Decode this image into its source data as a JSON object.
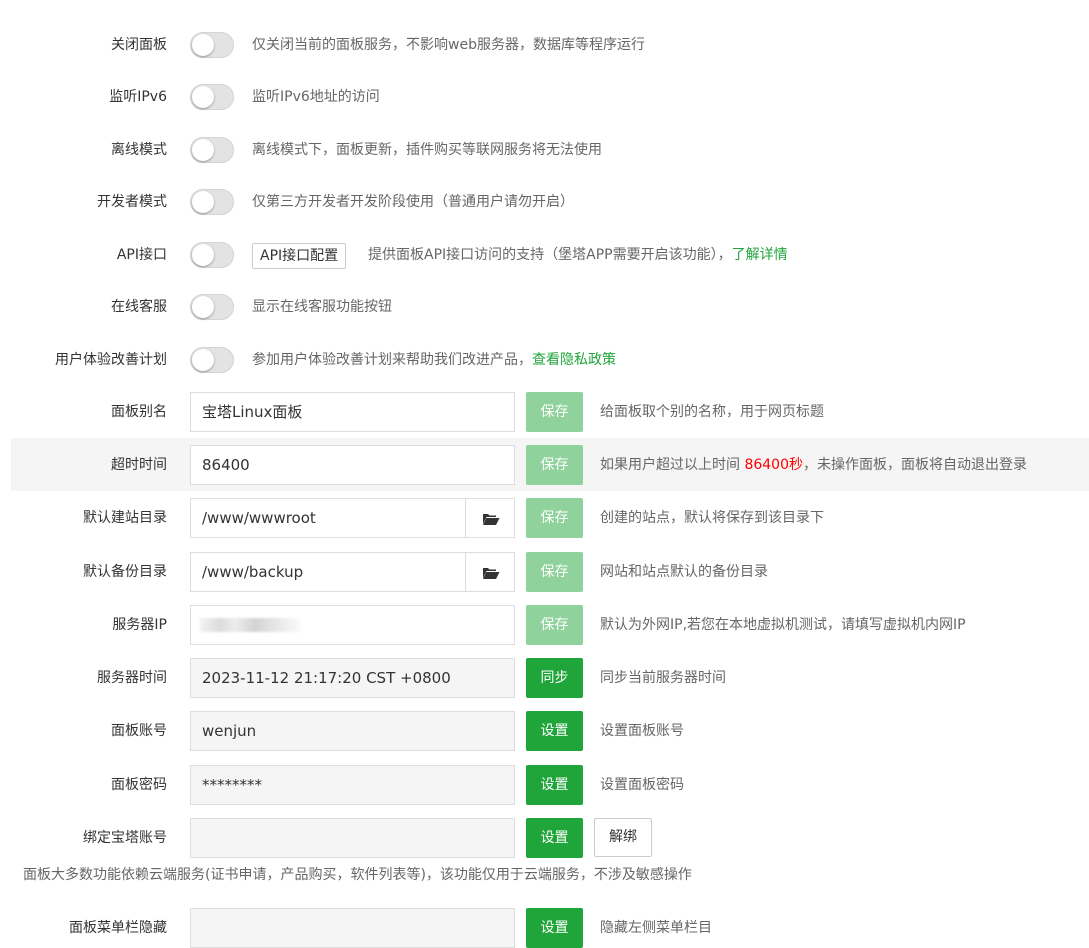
{
  "toggles": [
    {
      "label": "关闭面板",
      "enabled": false,
      "description": "仅关闭当前的面板服务，不影响web服务器，数据库等程序运行"
    },
    {
      "label": "监听IPv6",
      "enabled": false,
      "description": "监听IPv6地址的访问"
    },
    {
      "label": "离线模式",
      "enabled": false,
      "description": "离线模式下，面板更新，插件购买等联网服务将无法使用"
    },
    {
      "label": "开发者模式",
      "enabled": false,
      "description": "仅第三方开发者开发阶段使用（普通用户请勿开启）"
    },
    {
      "label": "API接口",
      "enabled": false,
      "button_label": "API接口配置",
      "description": "提供面板API接口访问的支持（堡塔APP需要开启该功能），",
      "link_text": "了解详情"
    },
    {
      "label": "在线客服",
      "enabled": false,
      "description": "显示在线客服功能按钮"
    },
    {
      "label": "用户体验改善计划",
      "enabled": false,
      "description": "参加用户体验改善计划来帮助我们改进产品，",
      "link_text": "查看隐私政策"
    }
  ],
  "fields": {
    "panel_alias": {
      "label": "面板别名",
      "value": "宝塔Linux面板",
      "button": "保存",
      "description": "给面板取个别的名称，用于网页标题"
    },
    "timeout": {
      "label": "超时时间",
      "value": "86400",
      "button": "保存",
      "description_prefix": "如果用户超过以上时间 ",
      "description_highlight": "86400秒",
      "description_suffix": "，未操作面板，面板将自动退出登录"
    },
    "site_dir": {
      "label": "默认建站目录",
      "value": "/www/wwwroot",
      "button": "保存",
      "description": "创建的站点，默认将保存到该目录下",
      "icon": "folder-open-icon"
    },
    "backup_dir": {
      "label": "默认备份目录",
      "value": "/www/backup",
      "button": "保存",
      "description": "网站和站点默认的备份目录",
      "icon": "folder-open-icon"
    },
    "server_ip": {
      "label": "服务器IP",
      "value": "",
      "button": "保存",
      "description": "默认为外网IP,若您在本地虚拟机测试，请填写虚拟机内网IP"
    },
    "server_time": {
      "label": "服务器时间",
      "value": "2023-11-12 21:17:20 CST +0800",
      "button": "同步",
      "description": "同步当前服务器时间"
    },
    "panel_account": {
      "label": "面板账号",
      "value": "wenjun",
      "button": "设置",
      "description": "设置面板账号"
    },
    "panel_password": {
      "label": "面板密码",
      "value": "********",
      "button": "设置",
      "description": "设置面板密码"
    },
    "bind_account": {
      "label": "绑定宝塔账号",
      "value": "",
      "button": "设置",
      "secondary_button": "解绑"
    },
    "menu_hide": {
      "label": "面板菜单栏隐藏",
      "value": "",
      "button": "设置",
      "description": "隐藏左侧菜单栏目"
    }
  },
  "cloud_note": "面板大多数功能依赖云端服务(证书申请，产品购买，软件列表等)，该功能仅用于云端服务，不涉及敏感操作",
  "colors": {
    "accent_green": "#20a53a",
    "faded_green": "#8fd29b",
    "highlight_red": "#ff0000"
  }
}
